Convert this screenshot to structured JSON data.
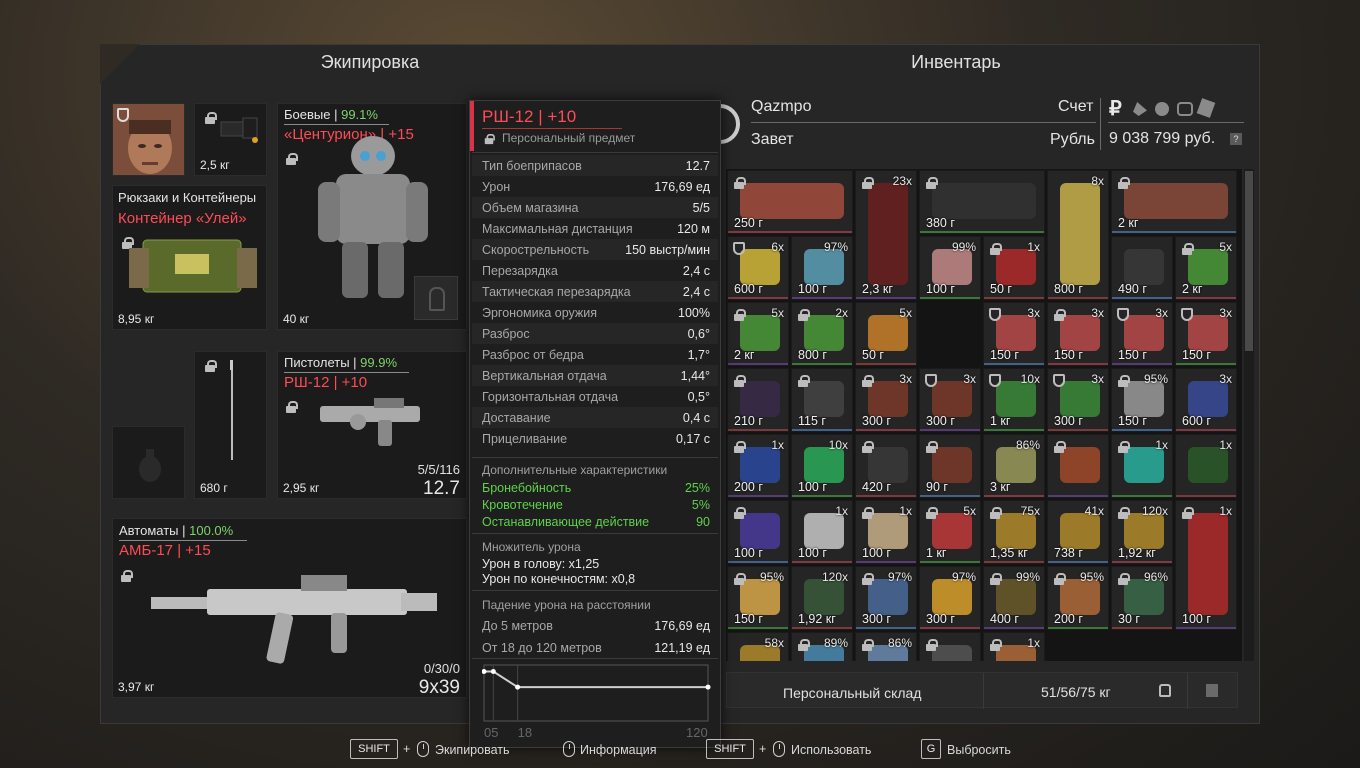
{
  "equipment": {
    "header": "Экипировка",
    "helmet_slot": {
      "weight": "2,5 кг"
    },
    "armor": {
      "category": "Боевые",
      "percent": "99.1%",
      "name": "«Центурион» | +15",
      "weight": "40 кг"
    },
    "container": {
      "category": "Рюкзаки и Контейнеры",
      "name": "Контейнер «Улей»",
      "weight": "8,95 кг"
    },
    "melee": {
      "weight": "680 г"
    },
    "pistol": {
      "category": "Пистолеты",
      "percent": "99.9%",
      "name": "РШ-12 | +10",
      "weight": "2,95 кг",
      "ammo": "5/5/116",
      "caliber": "12.7"
    },
    "rifle": {
      "category": "Автоматы",
      "percent": "100.0%",
      "name": "АМБ-17 | +15",
      "weight": "3,97 кг",
      "ammo": "0/30/0",
      "caliber": "9x39"
    }
  },
  "tooltip": {
    "title": "РШ-12 | +10",
    "subtitle": "Персональный предмет",
    "stats": [
      {
        "k": "Тип боеприпасов",
        "v": "12.7"
      },
      {
        "k": "Урон",
        "v": "176,69 ед"
      },
      {
        "k": "Объем магазина",
        "v": "5/5"
      },
      {
        "k": "Максимальная дистанция",
        "v": "120 м"
      },
      {
        "k": "Скорострельность",
        "v": "150 выстр/мин"
      },
      {
        "k": "Перезарядка",
        "v": "2,4 с"
      },
      {
        "k": "Тактическая перезарядка",
        "v": "2,4 с"
      },
      {
        "k": "Эргономика оружия",
        "v": "100%"
      },
      {
        "k": "Разброс",
        "v": "0,6°"
      },
      {
        "k": "Разброс от бедра",
        "v": "1,7°"
      },
      {
        "k": "Вертикальная отдача",
        "v": "1,44°"
      },
      {
        "k": "Горизонтальная отдача",
        "v": "0,5°"
      },
      {
        "k": "Доставание",
        "v": "0,4 с"
      },
      {
        "k": "Прицеливание",
        "v": "0,17 с"
      }
    ],
    "extra_header": "Дополнительные характеристики",
    "extra": [
      {
        "k": "Бронебойность",
        "v": "25%"
      },
      {
        "k": "Кровотечение",
        "v": "5%"
      },
      {
        "k": "Останавливающее действие",
        "v": "90"
      }
    ],
    "mult_header": "Множитель урона",
    "mult": [
      "Урон в голову: x1,25",
      "Урон по конечностям: x0,8"
    ],
    "falloff_header": "Падение урона на расстоянии",
    "falloff": [
      {
        "k": "До 5 метров",
        "v": "176,69 ед"
      },
      {
        "k": "От 18 до 120 метров",
        "v": "121,19 ед"
      }
    ],
    "falloff_chart": {
      "type": "line",
      "x": [
        0,
        5,
        18,
        120
      ],
      "y": [
        176.69,
        176.69,
        121.19,
        121.19
      ],
      "xticks": [
        "05",
        "18",
        "120"
      ]
    }
  },
  "inventory": {
    "header": "Инвентарь",
    "player": "Qazmpo",
    "faction": "Завет",
    "account_label": "Счет",
    "currency_label": "Рубль",
    "balance": "9 038 799 руб.",
    "help": "?",
    "storage_label": "Персональный склад",
    "storage_weight": "51/56/75 кг"
  },
  "items": [
    {
      "w": "250 г",
      "c": "",
      "lock": true,
      "col": "#a34c3c"
    },
    {
      "w": "2,3 кг",
      "c": "23x",
      "lock": true,
      "col": "#6b2020"
    },
    {
      "w": "380 г",
      "c": "",
      "lock": true,
      "col": "#333"
    },
    {
      "w": "800 г",
      "c": "8x",
      "lock": false,
      "col": "#c9b24a"
    },
    {
      "w": "2 кг",
      "c": "",
      "lock": true,
      "col": "#8a4a3a"
    },
    {
      "w": "600 г",
      "c": "6x",
      "shield": true,
      "col": "#d2b83a"
    },
    {
      "w": "100 г",
      "c": "97%",
      "col": "#5aa0b8"
    },
    {
      "w": "100 г",
      "c": "99%",
      "col": "#c58a8a"
    },
    {
      "w": "50 г",
      "c": "1x",
      "lock": true,
      "col": "#b02a2a"
    },
    {
      "w": "490 г",
      "c": "",
      "col": "#3a3a3a"
    },
    {
      "w": "2 кг",
      "c": "5x",
      "lock": true,
      "col": "#4a9a3a"
    },
    {
      "w": "2 кг",
      "c": "5x",
      "lock": true,
      "col": "#4a9a3a"
    },
    {
      "w": "800 г",
      "c": "2x",
      "lock": true,
      "col": "#4a9a3a"
    },
    {
      "w": "50 г",
      "c": "5x",
      "col": "#c9802a"
    },
    {
      "w": "150 г",
      "c": "3x",
      "shield": true,
      "col": "#b84a4a"
    },
    {
      "w": "150 г",
      "c": "3x",
      "lock": true,
      "col": "#b84a4a"
    },
    {
      "w": "150 г",
      "c": "3x",
      "shield": true,
      "col": "#b84a4a"
    },
    {
      "w": "150 г",
      "c": "3x",
      "shield": true,
      "col": "#b84a4a"
    },
    {
      "w": "210 г",
      "c": "",
      "lock": true,
      "col": "#3a2a4a"
    },
    {
      "w": "115 г",
      "c": "",
      "lock": true,
      "col": "#444"
    },
    {
      "w": "300 г",
      "c": "3x",
      "lock": true,
      "col": "#7a3a2a"
    },
    {
      "w": "300 г",
      "c": "3x",
      "shield": true,
      "col": "#7a3a2a"
    },
    {
      "w": "1 кг",
      "c": "10x",
      "shield": true,
      "col": "#3a8a3a"
    },
    {
      "w": "300 г",
      "c": "3x",
      "shield": true,
      "col": "#3a8a3a"
    },
    {
      "w": "150 г",
      "c": "95%",
      "lock": true,
      "col": "#9a9a9a"
    },
    {
      "w": "600 г",
      "c": "3x",
      "col": "#3a4a9a"
    },
    {
      "w": "200 г",
      "c": "1x",
      "lock": true,
      "col": "#2a4aa0"
    },
    {
      "w": "100 г",
      "c": "10x",
      "col": "#2aaa5a"
    },
    {
      "w": "420 г",
      "c": "",
      "lock": true,
      "col": "#3a3a3a"
    },
    {
      "w": "90 г",
      "c": "",
      "lock": true,
      "col": "#7a3a2a"
    },
    {
      "w": "3 кг",
      "c": "86%",
      "col": "#9a9a5a"
    },
    {
      "w": "",
      "c": "",
      "lock": true,
      "col": "#a04a2a"
    },
    {
      "w": "",
      "c": "1x",
      "lock": true,
      "col": "#2ab0a0"
    },
    {
      "w": "",
      "c": "1x",
      "col": "#2a5a2a"
    },
    {
      "w": "100 г",
      "c": "",
      "lock": true,
      "col": "#4a3a9a"
    },
    {
      "w": "100 г",
      "c": "1x",
      "col": "#c8c8c8"
    },
    {
      "w": "100 г",
      "c": "1x",
      "lock": true,
      "col": "#c8b08a"
    },
    {
      "w": "1 кг",
      "c": "5x",
      "lock": true,
      "col": "#c03a3a"
    },
    {
      "w": "1,35 кг",
      "c": "75x",
      "lock": true,
      "col": "#b08a2a"
    },
    {
      "w": "738 г",
      "c": "41x",
      "col": "#b08a2a"
    },
    {
      "w": "1,92 кг",
      "c": "120x",
      "lock": true,
      "col": "#b08a2a"
    },
    {
      "w": "100 г",
      "c": "1x",
      "lock": true,
      "col": "#b02a2a"
    },
    {
      "w": "150 г",
      "c": "95%",
      "lock": true,
      "col": "#d8a84a"
    },
    {
      "w": "1,92 кг",
      "c": "120x",
      "col": "#3a5a3a"
    },
    {
      "w": "300 г",
      "c": "97%",
      "lock": true,
      "col": "#4a6a9a"
    },
    {
      "w": "300 г",
      "c": "97%",
      "col": "#d8a02a"
    },
    {
      "w": "400 г",
      "c": "99%",
      "lock": true,
      "col": "#6a5a2a"
    },
    {
      "w": "200 г",
      "c": "95%",
      "lock": true,
      "col": "#b06a3a"
    },
    {
      "w": "30 г",
      "c": "96%",
      "lock": true,
      "col": "#3a6a4a"
    },
    {
      "w": "",
      "c": "58x",
      "col": "#b08a2a"
    },
    {
      "w": "",
      "c": "89%",
      "lock": true,
      "col": "#4a8ab0"
    },
    {
      "w": "",
      "c": "86%",
      "lock": true,
      "col": "#6a8ab0"
    },
    {
      "w": "",
      "c": "",
      "lock": true,
      "col": "#555"
    },
    {
      "w": "",
      "c": "1x",
      "lock": true,
      "col": "#b06a3a"
    }
  ],
  "hints": [
    {
      "key": "SHIFT",
      "label": "Экипировать"
    },
    {
      "key": "",
      "label": "Информация"
    },
    {
      "key": "SHIFT",
      "label": "Использовать"
    },
    {
      "key": "G",
      "label": "Выбросить"
    }
  ]
}
